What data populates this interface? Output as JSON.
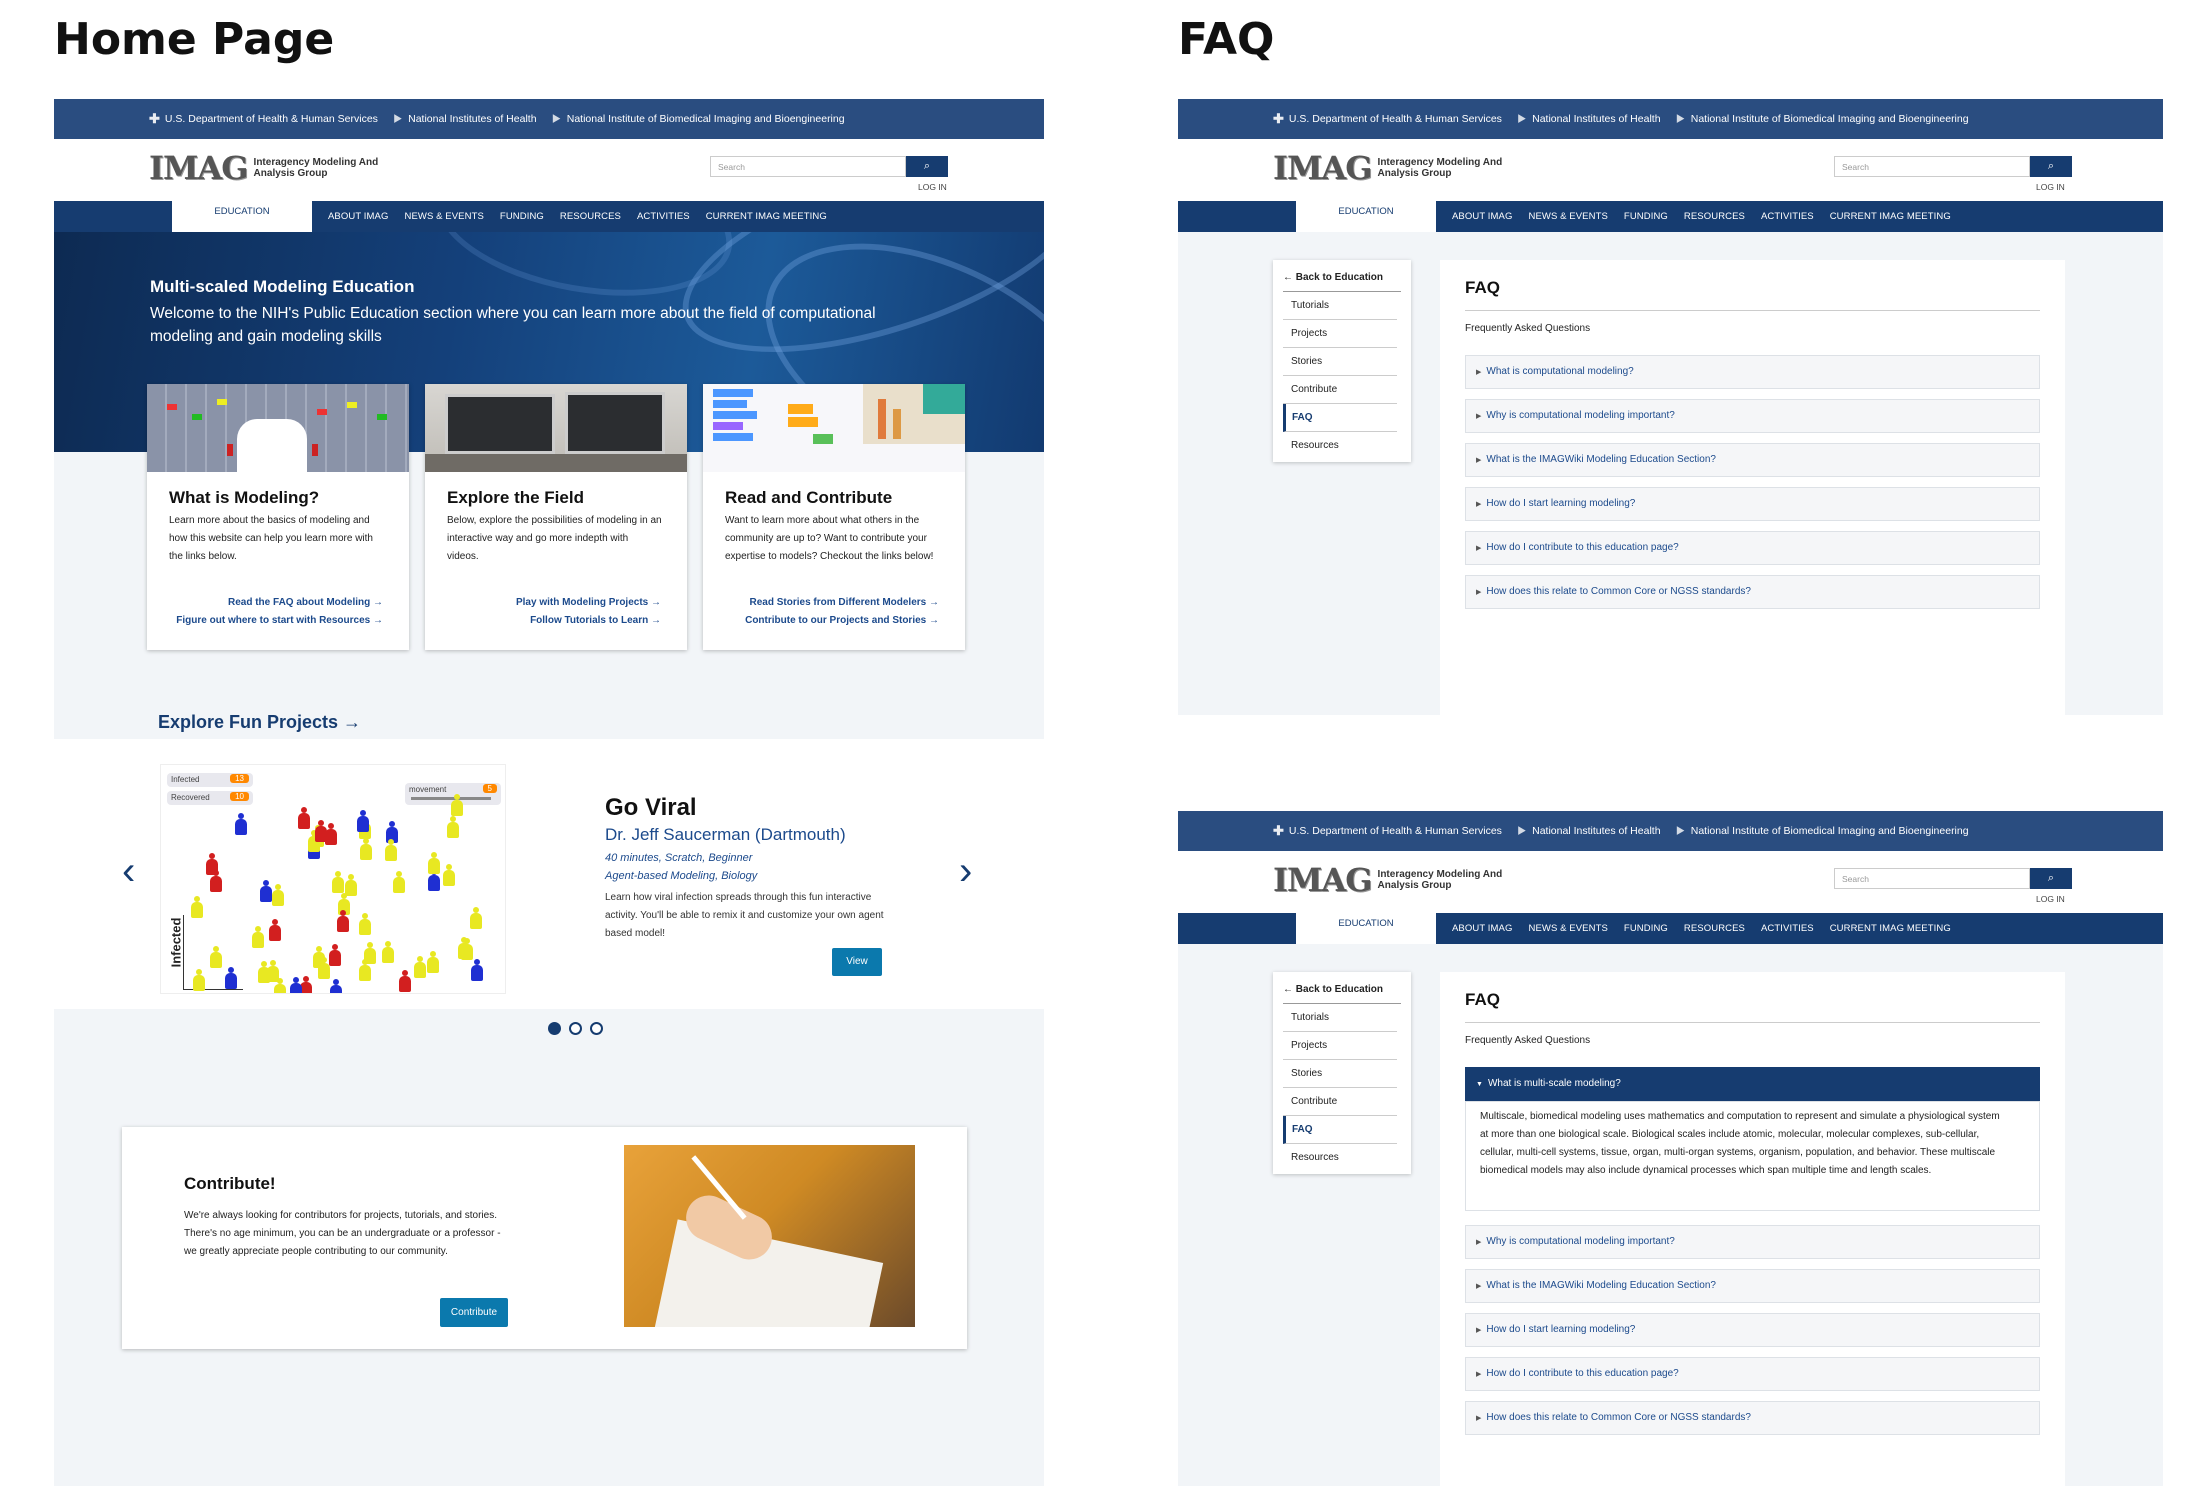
{
  "labels": {
    "home": "Home Page",
    "faq": "FAQ"
  },
  "gov": {
    "hhs": "U.S. Department of Health & Human Services",
    "nih": "National Institutes of Health",
    "nibib": "National Institute of Biomedical Imaging and Bioengineering"
  },
  "header": {
    "logo_mark": "IMAG",
    "logo_line1": "Interagency Modeling And",
    "logo_line2": "Analysis Group",
    "search_placeholder": "Search",
    "search_icon": "search-icon",
    "login": "LOG IN"
  },
  "nav": {
    "active": "EDUCATION",
    "items": [
      "ABOUT IMAG",
      "NEWS & EVENTS",
      "FUNDING",
      "RESOURCES",
      "ACTIVITIES",
      "CURRENT IMAG MEETING"
    ]
  },
  "hero": {
    "title": "Multi-scaled Modeling Education",
    "line1": "Welcome to the NIH's Public Education section where you can learn more about the field of computational",
    "line2": "modeling and gain modeling skills"
  },
  "cards": [
    {
      "title": "What is Modeling?",
      "text": "Learn more about the basics of modeling and how this website can help you learn more with the links below.",
      "link1": "Read the FAQ about Modeling →",
      "link2": "Figure out where to start with Resources →"
    },
    {
      "title": "Explore the Field",
      "text": "Below, explore the possibilities of modeling in an interactive way and go more indepth with videos.",
      "link1": "Play with Modeling Projects →",
      "link2": "Follow Tutorials to Learn →"
    },
    {
      "title": "Read and Contribute",
      "text": "Want to learn more about what others in the community are up to? Want to contribute your expertise to models? Checkout the links below!",
      "link1": "Read Stories from Different Modelers →",
      "link2": "Contribute to our Projects and Stories →"
    }
  ],
  "explore": "Explore Fun Projects →",
  "carousel": {
    "title": "Go Viral",
    "author": "Dr. Jeff Saucerman (Dartmouth)",
    "meta1": "40 minutes, Scratch, Beginner",
    "meta2": "Agent-based Modeling, Biology",
    "desc": "Learn how viral infection spreads through this fun interactive activity. You'll be able to remix it and customize your own agent based model!",
    "button": "View",
    "sim_infected": "Infected",
    "sim_infected_val": "13",
    "sim_recovered": "Recovered",
    "sim_recovered_val": "10",
    "sim_movement": "movement",
    "sim_movement_val": "5",
    "sim_axis": "Infected",
    "prev_icon": "chevron-left-icon",
    "next_icon": "chevron-right-icon",
    "active_slide": 1,
    "slide_count": 3
  },
  "contribute": {
    "title": "Contribute!",
    "l1": "We're always looking for contributors for projects, tutorials, and stories.",
    "l2": "There's no age minimum, you can be an undergraduate or a professor -",
    "l3": "we greatly appreciate people contributing to our community.",
    "button": "Contribute"
  },
  "faq": {
    "back": "← Back to Education",
    "side": [
      "Tutorials",
      "Projects",
      "Stories",
      "Contribute",
      "FAQ",
      "Resources"
    ],
    "title": "FAQ",
    "subtitle": "Frequently Asked Questions",
    "questions_a": [
      "What is computational modeling?",
      "Why is computational modeling  important?",
      "What is the IMAGWiki Modeling Education Section?",
      "How do I start learning modeling?",
      "How do I contribute to this education page?",
      "How does this relate to Common Core or NGSS standards?"
    ],
    "open_q": "What is multi-scale modeling?",
    "answer": [
      "Multiscale, biomedical modeling uses mathematics and computation to represent and simulate a physiological system",
      "at more than one biological scale. Biological scales include atomic, molecular, molecular complexes, sub-cellular,",
      "cellular, multi-cell systems, tissue, organ, multi-organ systems, organism, population, and behavior. These multiscale",
      "biomedical models may also include dynamical processes which span multiple time and length scales."
    ],
    "questions_b": [
      "Why is computational modeling  important?",
      "What is the IMAGWiki Modeling Education Section?",
      "How do I start learning modeling?",
      "How do I contribute to this education page?",
      "How does this relate to Common Core or NGSS standards?"
    ]
  }
}
